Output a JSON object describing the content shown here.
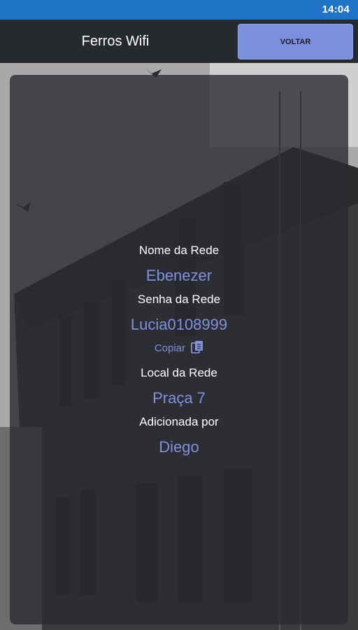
{
  "status_bar": {
    "time": "14:04"
  },
  "app_bar": {
    "title": "Ferros Wifi",
    "back_label": "VOLTAR"
  },
  "network": {
    "name_label": "Nome da Rede",
    "name_value": "Ebenezer",
    "password_label": "Senha da Rede",
    "password_value": "Lucia0108999",
    "copy_label": "Copiar",
    "location_label": "Local da Rede",
    "location_value": "Praça 7",
    "added_by_label": "Adicionada por",
    "added_by_value": "Diego"
  },
  "icons": {
    "copy": "copy-icon"
  },
  "colors": {
    "status_bar": "#1f74c8",
    "app_bar": "#26292e",
    "accent": "#7b8fdd",
    "value_text": "#7f91df"
  }
}
